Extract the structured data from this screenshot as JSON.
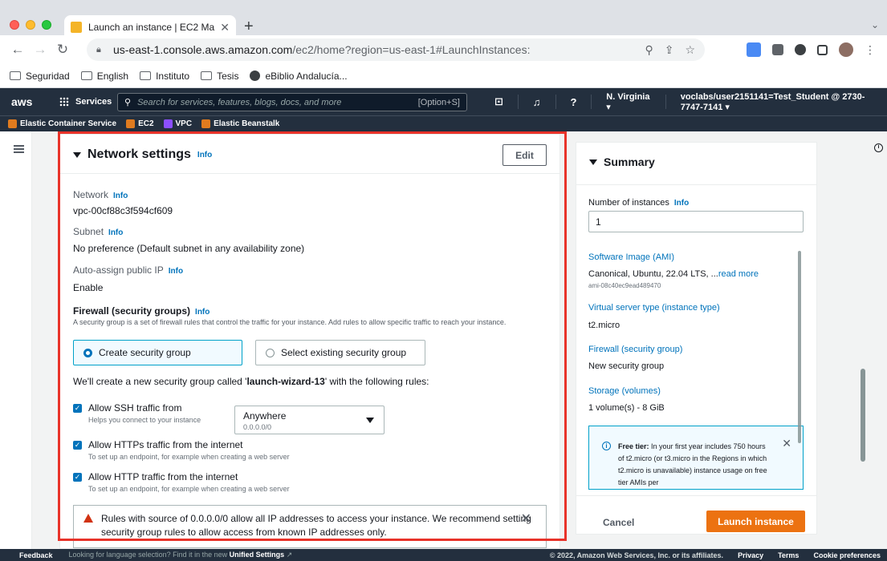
{
  "browser": {
    "tab_title": "Launch an instance | EC2 Mana",
    "url_host": "us-east-1.console.aws.amazon.com",
    "url_path": "/ec2/home?region=us-east-1#LaunchInstances:",
    "bookmarks": [
      "Seguridad",
      "English",
      "Instituto",
      "Tesis",
      "eBiblio Andalucía..."
    ]
  },
  "aws_header": {
    "logo": "aws",
    "services_label": "Services",
    "search_placeholder": "Search for services, features, blogs, docs, and more",
    "search_shortcut": "[Option+S]",
    "region": "N. Virginia ▾",
    "account": "voclabs/user2151141=Test_Student @ 2730-7747-7141 ▾",
    "favorites": [
      "Elastic Container Service",
      "EC2",
      "VPC",
      "Elastic Beanstalk"
    ]
  },
  "network": {
    "title": "Network settings",
    "info": "Info",
    "edit_label": "Edit",
    "network_label": "Network",
    "network_value": "vpc-00cf88c3f594cf609",
    "subnet_label": "Subnet",
    "subnet_value": "No preference (Default subnet in any availability zone)",
    "public_ip_label": "Auto-assign public IP",
    "public_ip_value": "Enable",
    "firewall_label": "Firewall (security groups)",
    "firewall_desc": "A security group is a set of firewall rules that control the traffic for your instance. Add rules to allow specific traffic to reach your instance.",
    "option_create": "Create security group",
    "option_existing": "Select existing security group",
    "sg_text_prefix": "We'll create a new security group called '",
    "sg_name": "launch-wizard-13",
    "sg_text_suffix": "' with the following rules:",
    "rules": [
      {
        "title": "Allow SSH traffic from",
        "desc": "Helps you connect to your instance"
      },
      {
        "title": "Allow HTTPs traffic from the internet",
        "desc": "To set up an endpoint, for example when creating a web server"
      },
      {
        "title": "Allow HTTP traffic from the internet",
        "desc": "To set up an endpoint, for example when creating a web server"
      }
    ],
    "ssh_source": "Anywhere",
    "ssh_cidr": "0.0.0.0/0",
    "warning_line1": "Rules with source of 0.0.0.0/0 allow all IP addresses to access your instance. We recommend setting",
    "warning_line2": "security group rules to allow access from known IP addresses only."
  },
  "summary": {
    "title": "Summary",
    "instances_label": "Number of instances",
    "instances_value": "1",
    "ami_label": "Software Image (AMI)",
    "ami_value": "Canonical, Ubuntu, 22.04 LTS, ...",
    "ami_read_more": "read more",
    "ami_id": "ami-08c40ec9ead489470",
    "instance_type_label": "Virtual server type (instance type)",
    "instance_type_value": "t2.micro",
    "firewall_label": "Firewall (security group)",
    "firewall_value": "New security group",
    "storage_label": "Storage (volumes)",
    "storage_value": "1 volume(s) - 8 GiB",
    "free_tier_bold": "Free tier:",
    "free_tier_text": " In your first year includes 750 hours of t2.micro (or t3.micro in the Regions in which t2.micro is unavailable) instance usage on free tier AMIs per",
    "cancel_label": "Cancel",
    "launch_label": "Launch instance"
  },
  "footer": {
    "feedback": "Feedback",
    "lang_prefix": "Looking for language selection? Find it in the new ",
    "lang_link": "Unified Settings",
    "copyright": "© 2022, Amazon Web Services, Inc. or its affiliates.",
    "privacy": "Privacy",
    "terms": "Terms",
    "cookies": "Cookie preferences"
  },
  "colors": {
    "aws_nav": "#232f3e",
    "link": "#0073bb",
    "launch": "#ec7211",
    "highlight_box": "#e8332a"
  }
}
